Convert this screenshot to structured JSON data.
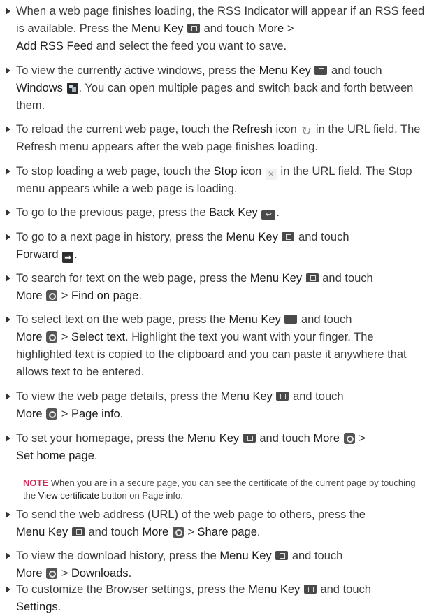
{
  "items": [
    {
      "parts": [
        "When a web page finishes loading, the RSS Indicator will appear if an RSS feed is available. Press the ",
        "Menu Key",
        " and touch ",
        "More",
        " > ",
        "Add RSS Feed",
        " and select the feed you want to save."
      ]
    },
    {
      "parts": [
        "To view the currently active windows, press the ",
        "Menu Key",
        " and touch ",
        "Windows",
        ". You can open multiple pages and switch back and forth between them."
      ]
    },
    {
      "parts": [
        "To reload the current web page, touch the ",
        "Refresh",
        " icon ",
        " in the URL field. The Refresh menu appears after the web page finishes loading."
      ]
    },
    {
      "parts": [
        "To stop loading a web page, touch the ",
        "Stop",
        " icon ",
        " in the URL field. The Stop menu appears while a web page is loading."
      ]
    },
    {
      "parts": [
        "To go to the previous page, press the ",
        "Back Key",
        "."
      ]
    },
    {
      "parts": [
        "To go to a next page in history, press the ",
        "Menu Key",
        " and touch ",
        "Forward",
        "."
      ]
    },
    {
      "parts": [
        "To search for text on the web page, press the ",
        "Menu Key",
        " and touch ",
        "More",
        " > ",
        "Find on page",
        "."
      ]
    },
    {
      "parts": [
        "To select text on the web page, press the ",
        "Menu Key",
        " and touch ",
        "More",
        " > ",
        "Select text",
        ". Highlight the text you want with your finger. The highlighted text is copied to the clipboard and you can paste it anywhere that allows text to be entered."
      ]
    },
    {
      "parts": [
        "To view the web page details, press the ",
        "Menu Key",
        " and touch ",
        "More",
        " > ",
        "Page info",
        "."
      ]
    },
    {
      "parts": [
        "To set your homepage, press the ",
        "Menu Key",
        " and touch ",
        "More",
        " > ",
        "Set home page",
        "."
      ]
    },
    {
      "parts": [
        "To send the web address (URL) of the web page to others, press the ",
        "Menu Key",
        " and touch ",
        "More",
        " > ",
        "Share page",
        "."
      ]
    },
    {
      "parts": [
        "To view the download history, press the ",
        "Menu Key",
        " and touch ",
        "More",
        " > ",
        "Downloads",
        "."
      ]
    },
    {
      "parts": [
        "To customize the Browser settings, press the ",
        "Menu Key",
        " and touch ",
        "Settings",
        "."
      ]
    }
  ],
  "note": {
    "label": "NOTE",
    "parts": [
      " When you are in a secure page, you can see the certificate of the current page by touching the ",
      "View certificate",
      " button on Page info."
    ]
  },
  "icons": {
    "menu_key": "menu-key-icon",
    "windows": "windows-icon",
    "refresh": "refresh-icon",
    "stop": "stop-icon",
    "back_key": "back-key-icon",
    "forward": "forward-icon",
    "more": "more-icon"
  }
}
